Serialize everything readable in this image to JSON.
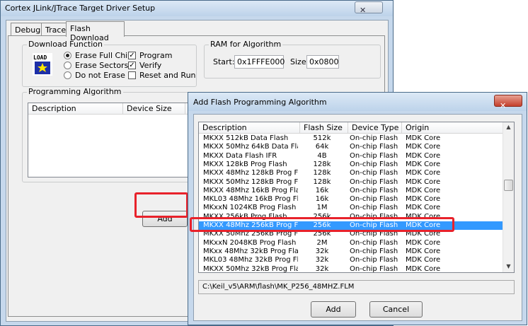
{
  "main_window": {
    "title": "Cortex JLink/JTrace Target Driver Setup",
    "close_glyph": "✕",
    "tabs": [
      "Debug",
      "Trace",
      "Flash Download"
    ],
    "active_tab": "Flash Download",
    "download_function": {
      "label": "Download Function",
      "logo_text": "LOAD",
      "radios": [
        {
          "label": "Erase Full Chip",
          "selected": true
        },
        {
          "label": "Erase Sectors",
          "selected": false
        },
        {
          "label": "Do not Erase",
          "selected": false
        }
      ],
      "checks": [
        {
          "label": "Program",
          "checked": true
        },
        {
          "label": "Verify",
          "checked": true
        },
        {
          "label": "Reset and Run",
          "checked": false
        }
      ]
    },
    "ram": {
      "label": "RAM for Algorithm",
      "start_label": "Start:",
      "start_value": "0x1FFFE000",
      "size_label": "Size:",
      "size_value": "0x0800"
    },
    "programming_algorithm": {
      "label": "Programming Algorithm",
      "columns": [
        "Description",
        "Device Size",
        "D"
      ]
    },
    "add_button": "Add"
  },
  "dialog": {
    "title": "Add Flash Programming Algorithm",
    "close_glyph": "✕",
    "columns": [
      "Description",
      "Flash Size",
      "Device Type",
      "Origin"
    ],
    "rows": [
      {
        "description": "MKXX 512kB Data Flash",
        "size": "512k",
        "type": "On-chip Flash",
        "origin": "MDK Core"
      },
      {
        "description": "MKXX 50Mhz 64kB Data Flash",
        "size": "64k",
        "type": "On-chip Flash",
        "origin": "MDK Core"
      },
      {
        "description": "MKXX Data Flash IFR",
        "size": "4B",
        "type": "On-chip Flash",
        "origin": "MDK Core"
      },
      {
        "description": "MKXX 128kB Prog Flash",
        "size": "128k",
        "type": "On-chip Flash",
        "origin": "MDK Core"
      },
      {
        "description": "MKXX 48Mhz 128kB Prog Fl...",
        "size": "128k",
        "type": "On-chip Flash",
        "origin": "MDK Core"
      },
      {
        "description": "MKXX 50Mhz 128kB Prog Fl...",
        "size": "128k",
        "type": "On-chip Flash",
        "origin": "MDK Core"
      },
      {
        "description": "MKXX 48Mhz 16kB Prog Flash",
        "size": "16k",
        "type": "On-chip Flash",
        "origin": "MDK Core"
      },
      {
        "description": "MKL03 48Mhz 16kB Prog Fl...",
        "size": "16k",
        "type": "On-chip Flash",
        "origin": "MDK Core"
      },
      {
        "description": "MKxxN 1024KB Prog Flash",
        "size": "1M",
        "type": "On-chip Flash",
        "origin": "MDK Core"
      },
      {
        "description": "MKXX 256kB Prog Flash",
        "size": "256k",
        "type": "On-chip Flash",
        "origin": "MDK Core"
      },
      {
        "description": "MKXX 48Mhz 256kB Prog Fl...",
        "size": "256k",
        "type": "On-chip Flash",
        "origin": "MDK Core"
      },
      {
        "description": "MKXX 50Mhz 256kB Prog Fl...",
        "size": "256k",
        "type": "On-chip Flash",
        "origin": "MDK Core"
      },
      {
        "description": "MKxxN 2048KB Prog Flash",
        "size": "2M",
        "type": "On-chip Flash",
        "origin": "MDK Core"
      },
      {
        "description": "MKxx 48Mhz 32kB Prog Flash",
        "size": "32k",
        "type": "On-chip Flash",
        "origin": "MDK Core"
      },
      {
        "description": "MKL03 48Mhz 32kB Prog Fl...",
        "size": "32k",
        "type": "On-chip Flash",
        "origin": "MDK Core"
      },
      {
        "description": "MKXX 50Mhz 32kB Prog Flash",
        "size": "32k",
        "type": "On-chip Flash",
        "origin": "MDK Core"
      }
    ],
    "selected_index": 10,
    "path": "C:\\Keil_v5\\ARM\\flash\\MK_P256_48MHZ.FLM",
    "add_button": "Add",
    "cancel_button": "Cancel",
    "scroll_up_glyph": "▲",
    "scroll_down_glyph": "▼"
  },
  "colors": {
    "highlight": "#e8222b",
    "selection": "#3399ff"
  }
}
